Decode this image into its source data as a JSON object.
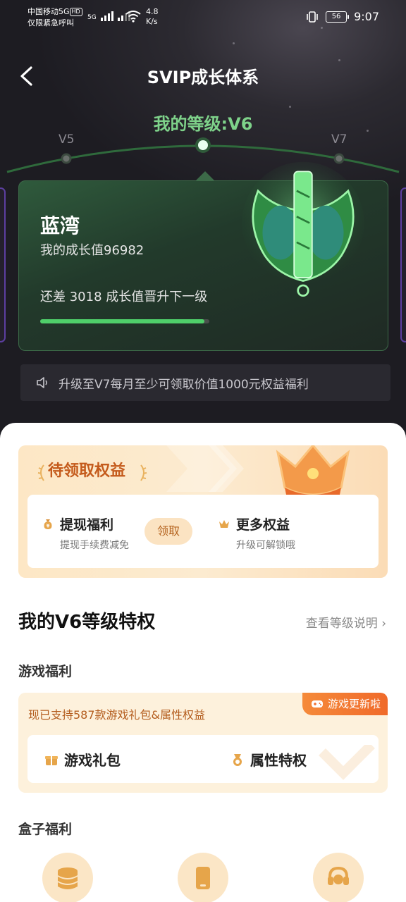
{
  "status_bar": {
    "carrier_line1": "中国移动5G",
    "hd": "HD",
    "carrier_line2": "仅限紧急呼叫",
    "net1": "5G",
    "speed_value": "4.8",
    "speed_unit": "K/s",
    "battery": "56",
    "time": "9:07"
  },
  "nav": {
    "title": "SVIP成长体系"
  },
  "level": {
    "current_label": "我的等级:V6",
    "prev": "V5",
    "next": "V7"
  },
  "card": {
    "name": "蓝湾",
    "growth": "我的成长值96982",
    "diff": "还差 3018 成长值晋升下一级",
    "progress": 0.97
  },
  "notice": {
    "text": "升级至V7每月至少可领取价值1000元权益福利"
  },
  "pending": {
    "title": "待领取权益",
    "items": [
      {
        "title": "提现福利",
        "subtitle": "提现手续费减免",
        "icon": "money-bag-icon"
      },
      {
        "title": "更多权益",
        "subtitle": "升级可解锁哦",
        "icon": "crown-icon"
      }
    ],
    "claim_label": "领取"
  },
  "privileges": {
    "title": "我的V6等级特权",
    "link": "查看等级说明"
  },
  "game": {
    "section_title": "游戏福利",
    "tag": "游戏更新啦",
    "desc": "现已支持587款游戏礼包&属性权益",
    "items": [
      {
        "label": "游戏礼包",
        "icon": "gift-icon"
      },
      {
        "label": "属性特权",
        "icon": "medal-icon"
      }
    ]
  },
  "box": {
    "section_title": "盒子福利",
    "icons": [
      "coins-icon",
      "phone-icon",
      "headset-icon"
    ]
  },
  "colors": {
    "accent_green": "#7ed28a",
    "progress_green": "#4fcf6a",
    "orange_text": "#c45a1b",
    "tag_orange": "#f06a2a"
  }
}
